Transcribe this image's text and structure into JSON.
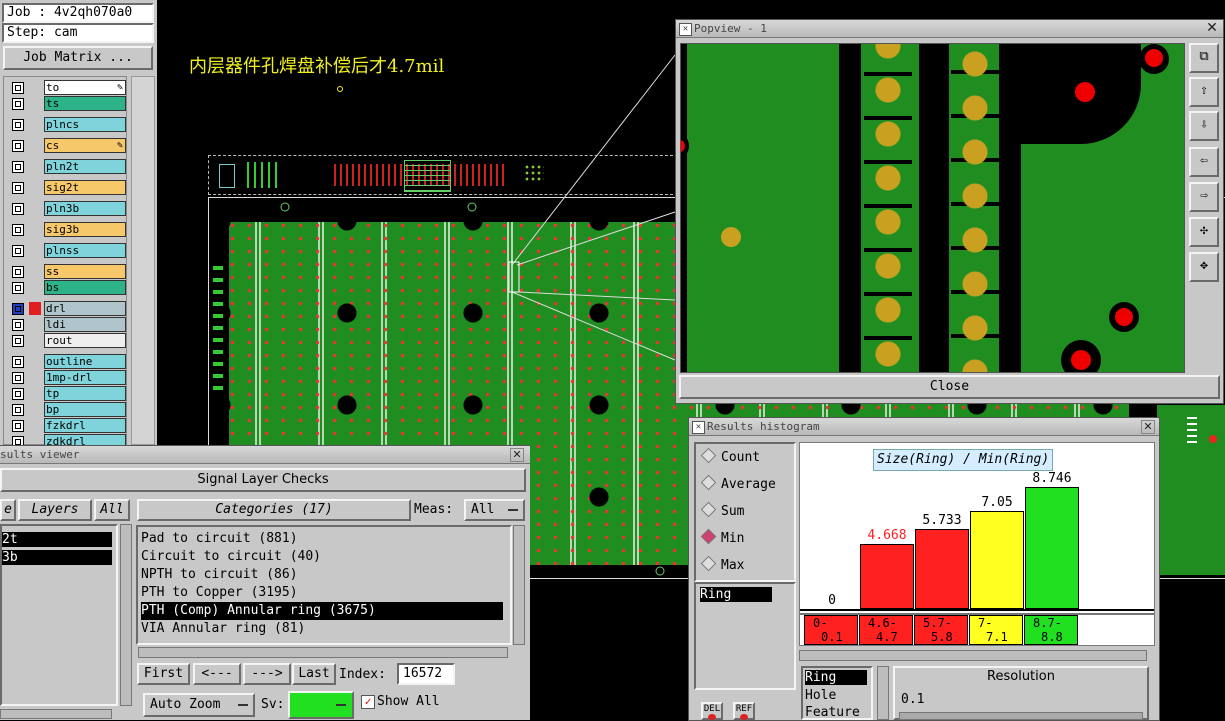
{
  "job": {
    "job_label": "Job : 4v2qh070a0",
    "step_label": "Step: cam",
    "matrix_button": "Job Matrix ..."
  },
  "annotation": "内层器件孔焊盘补偿后才4.7mil",
  "layers": [
    {
      "name": "to",
      "color": "#ffffff"
    },
    {
      "name": "ts",
      "color": "#2cb38a"
    },
    {
      "name": "plncs",
      "color": "#7fd4dc"
    },
    {
      "name": "cs",
      "color": "#f7c86a"
    },
    {
      "name": "pln2t",
      "color": "#7fd4dc"
    },
    {
      "name": "sig2t",
      "color": "#f7c86a"
    },
    {
      "name": "pln3b",
      "color": "#7fd4dc"
    },
    {
      "name": "sig3b",
      "color": "#f7c86a"
    },
    {
      "name": "plnss",
      "color": "#7fd4dc"
    },
    {
      "name": "ss",
      "color": "#f7c86a"
    },
    {
      "name": "bs",
      "color": "#2cb38a"
    },
    {
      "name": "drl",
      "color": "#b0c4cc"
    },
    {
      "name": "ldi",
      "color": "#b0c4cc"
    },
    {
      "name": "rout",
      "color": "#eeeeee"
    },
    {
      "name": "outline",
      "color": "#7fd4dc"
    },
    {
      "name": "1mp-drl",
      "color": "#7fd4dc"
    },
    {
      "name": "tp",
      "color": "#7fd4dc"
    },
    {
      "name": "bp",
      "color": "#7fd4dc"
    },
    {
      "name": "fzkdrl",
      "color": "#7fd4dc"
    },
    {
      "name": "zdkdrl",
      "color": "#7fd4dc"
    }
  ],
  "popview": {
    "title": "Popview - 1",
    "close_label": "Close"
  },
  "results_viewer": {
    "title": "sults viewer",
    "header": "Signal Layer Checks",
    "left_tab": "e",
    "layers_tab": "Layers",
    "all_tab": "All",
    "layer_rows": [
      "2t",
      "3b"
    ],
    "categories_label": "Categories (17)",
    "meas_label": "Meas:",
    "meas_value": "All",
    "categories": [
      "Pad to circuit (881)",
      "Circuit to circuit (40)",
      "NPTH to circuit (86)",
      "PTH to Copper (3195)",
      "PTH (Comp) Annular ring (3675)",
      "VIA Annular ring (81)"
    ],
    "selected_category_index": 4,
    "first_btn": "First",
    "prev_btn": "<---",
    "next_btn": "--->",
    "last_btn": "Last",
    "index_label": "Index:",
    "index_value": "16572",
    "auto_zoom": "Auto Zoom",
    "sv_label": "Sv:",
    "show_all_label": "Show All"
  },
  "histogram": {
    "title": "Results histogram",
    "options": [
      "Count",
      "Average",
      "Sum",
      "Min",
      "Max"
    ],
    "selected_option": "Min",
    "measure_item": "Ring",
    "chart_title": "Size(Ring) / Min(Ring)",
    "bins": [
      {
        "value": "0",
        "label_top": "0-",
        "label_bottom": "0.1",
        "color": "#ff2020",
        "height": 0
      },
      {
        "value": "4.668",
        "label_top": "4.6-",
        "label_bottom": "4.7",
        "color": "#ff2020",
        "height": 4.668,
        "value_color": "#ff2020"
      },
      {
        "value": "5.733",
        "label_top": "5.7-",
        "label_bottom": "5.8",
        "color": "#ff2020",
        "height": 5.733
      },
      {
        "value": "7.05",
        "label_top": "7-",
        "label_bottom": "7.1",
        "color": "#ffff20",
        "height": 7.05
      },
      {
        "value": "8.746",
        "label_top": "8.7-",
        "label_bottom": "8.8",
        "color": "#20e020",
        "height": 8.746
      }
    ],
    "list_items": [
      "Ring",
      "Hole",
      "Feature"
    ],
    "resolution_label": "Resolution",
    "resolution_value": "0.1",
    "del_label": "DEL",
    "ref_label": "REF"
  }
}
